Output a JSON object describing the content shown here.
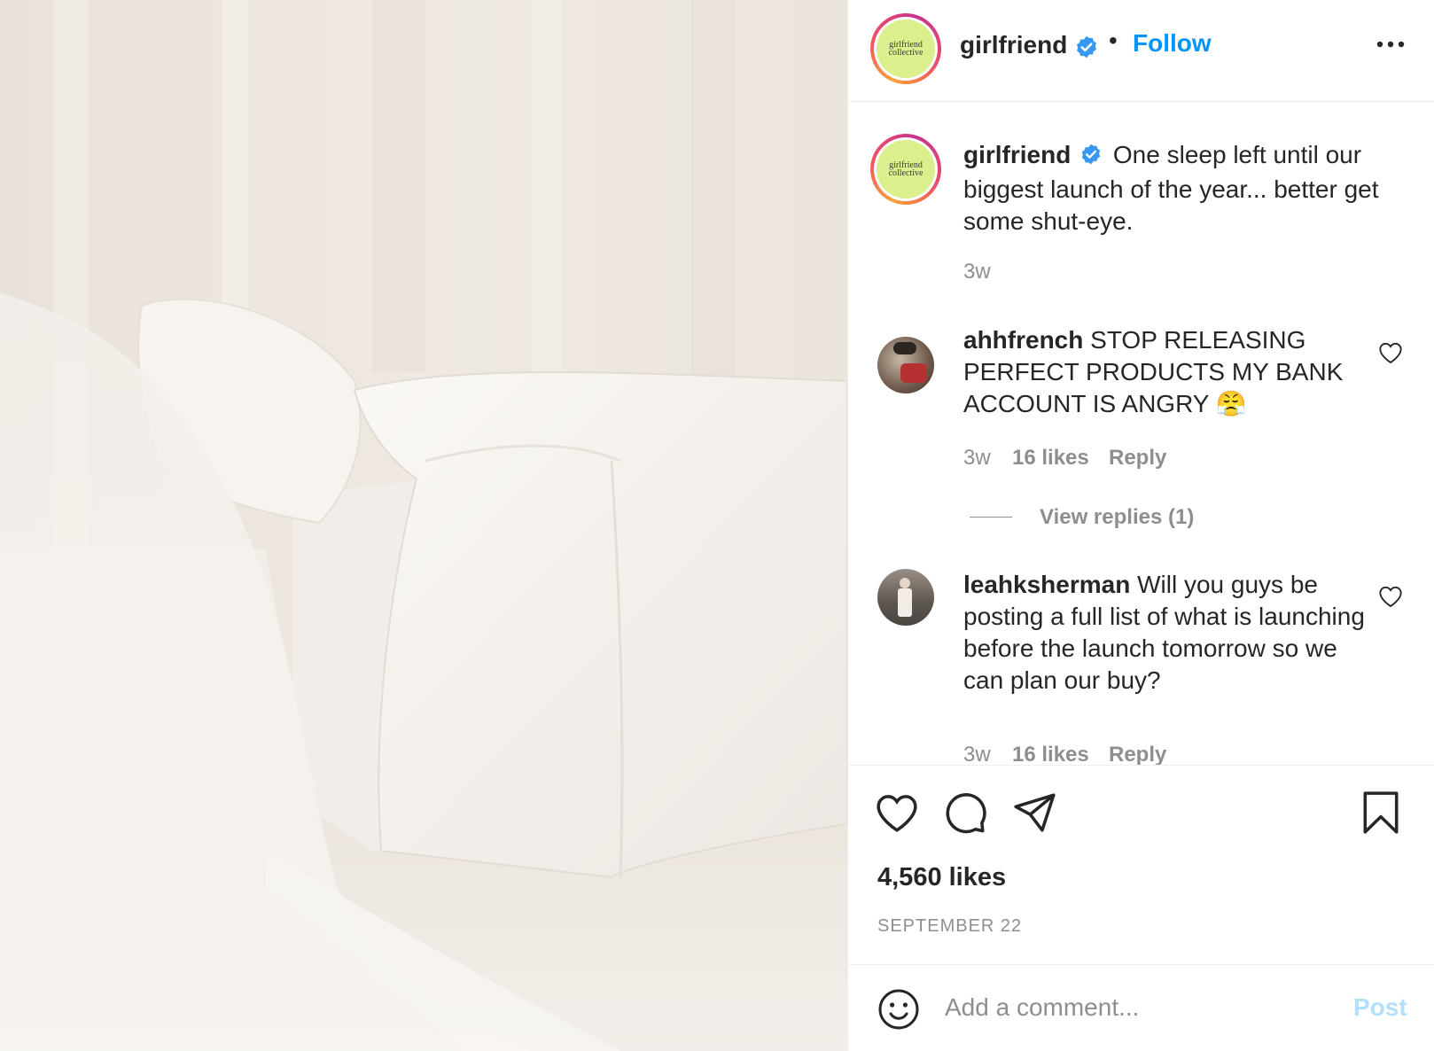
{
  "post": {
    "header": {
      "username": "girlfriend",
      "avatar_text_line1": "girlfriend",
      "avatar_text_line2": "collective",
      "separator": "•",
      "follow_label": "Follow",
      "more_icon": "more-horizontal-icon"
    },
    "caption": {
      "username": "girlfriend",
      "text": "One sleep left until our biggest launch of the year... better get some shut-eye.",
      "time": "3w"
    },
    "comments": [
      {
        "username": "ahhfrench",
        "text": "STOP RELEASING PERFECT PRODUCTS MY BANK ACCOUNT IS ANGRY 😤",
        "time": "3w",
        "likes": "16 likes",
        "reply_label": "Reply",
        "view_replies": "View replies (1)"
      },
      {
        "username": "leahksherman",
        "text": "Will you guys be posting a full list of what is launching before the launch tomorrow so we can plan our buy?",
        "time": "3w",
        "likes": "16 likes",
        "reply_label": "Reply"
      }
    ],
    "actions": {
      "like_icon": "heart-icon",
      "comment_icon": "comment-icon",
      "share_icon": "paper-plane-icon",
      "save_icon": "bookmark-icon"
    },
    "likes_count": "4,560 likes",
    "date": "SEPTEMBER 22",
    "add_comment": {
      "placeholder": "Add a comment...",
      "post_label": "Post",
      "emoji_icon": "smiley-icon"
    }
  },
  "colors": {
    "link_blue": "#0095f6",
    "post_disabled": "#b2dffc",
    "avatar_bg": "#dbef8d",
    "verified_blue": "#3897f0"
  }
}
